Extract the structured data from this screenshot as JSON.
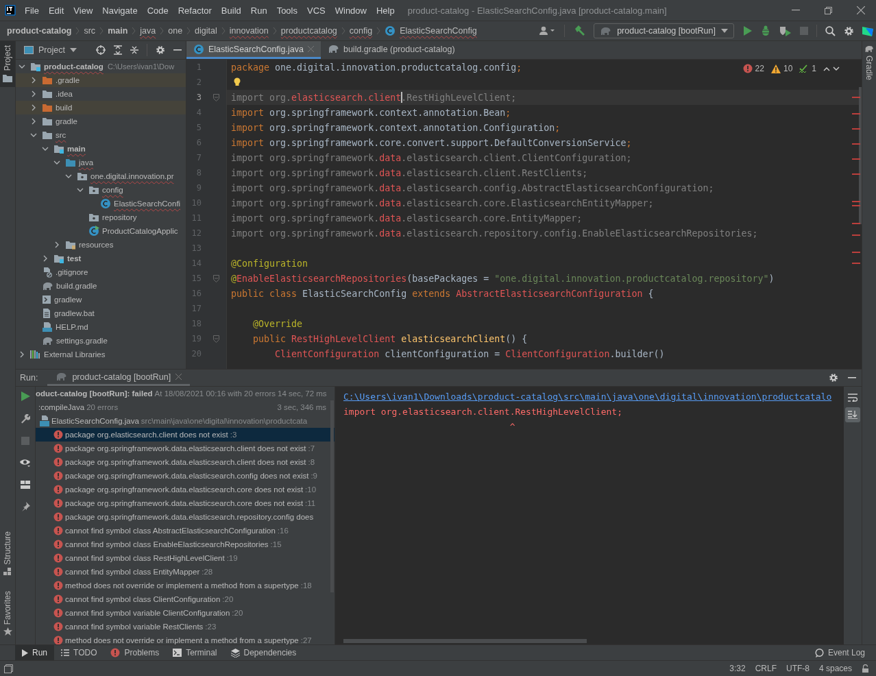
{
  "window": {
    "title": "product-catalog - ElasticSearchConfig.java [product-catalog.main]"
  },
  "menu": [
    "File",
    "Edit",
    "View",
    "Navigate",
    "Code",
    "Refactor",
    "Build",
    "Run",
    "Tools",
    "VCS",
    "Window",
    "Help"
  ],
  "breadcrumbs": [
    {
      "label": "product-catalog",
      "kind": "plain",
      "bold": true,
      "typo": false
    },
    {
      "label": "src",
      "kind": "plain",
      "bold": false,
      "typo": false
    },
    {
      "label": "main",
      "kind": "plain",
      "bold": true,
      "typo": false
    },
    {
      "label": "java",
      "kind": "plain",
      "bold": false,
      "typo": true
    },
    {
      "label": "one",
      "kind": "plain",
      "bold": false,
      "typo": false
    },
    {
      "label": "digital",
      "kind": "plain",
      "bold": false,
      "typo": false
    },
    {
      "label": "innovation",
      "kind": "plain",
      "bold": false,
      "typo": true
    },
    {
      "label": "productcatalog",
      "kind": "plain",
      "bold": false,
      "typo": true
    },
    {
      "label": "config",
      "kind": "plain",
      "bold": false,
      "typo": true
    },
    {
      "label": "ElasticSearchConfig",
      "kind": "class",
      "bold": false,
      "typo": true
    }
  ],
  "toolbar": {
    "run_config": "product-catalog [bootRun]"
  },
  "left_strip": {
    "top": [
      {
        "label": "Project",
        "selected": true
      }
    ],
    "bottom": [
      {
        "label": "Structure",
        "kind": "structure"
      },
      {
        "label": "Favorites",
        "kind": "favorites"
      }
    ]
  },
  "right_strip": [
    {
      "label": "Gradle"
    }
  ],
  "project": {
    "title": "Project",
    "tree": [
      {
        "label": "product-catalog",
        "path": "C:\\Users\\ivan1\\Dow",
        "kind": "module",
        "bold": true,
        "typo": true,
        "expanded": true,
        "children": [
          {
            "label": ".gradle",
            "kind": "excluded-folder",
            "bold": false,
            "typo": false,
            "expanded": false
          },
          {
            "label": ".idea",
            "kind": "folder",
            "bold": false,
            "typo": false,
            "expanded": false
          },
          {
            "label": "build",
            "kind": "excluded-folder",
            "bold": false,
            "typo": false,
            "expanded": false
          },
          {
            "label": "gradle",
            "kind": "folder",
            "bold": false,
            "typo": false,
            "expanded": false
          },
          {
            "label": "src",
            "kind": "folder",
            "bold": false,
            "typo": true,
            "expanded": true,
            "children": [
              {
                "label": "main",
                "kind": "module",
                "bold": true,
                "typo": true,
                "expanded": true,
                "children": [
                  {
                    "label": "java",
                    "kind": "source-folder",
                    "bold": false,
                    "typo": true,
                    "expanded": true,
                    "children": [
                      {
                        "label": "one.digital.innovation.pr",
                        "kind": "package",
                        "bold": false,
                        "typo": true,
                        "expanded": true,
                        "children": [
                          {
                            "label": "config",
                            "kind": "package",
                            "bold": false,
                            "typo": true,
                            "expanded": true,
                            "children": [
                              {
                                "label": "ElasticSearchConfi",
                                "kind": "class",
                                "bold": false,
                                "typo": true
                              }
                            ]
                          },
                          {
                            "label": "repository",
                            "kind": "package",
                            "bold": false,
                            "typo": false
                          },
                          {
                            "label": "ProductCatalogApplic",
                            "kind": "main-class",
                            "bold": false,
                            "typo": false
                          }
                        ]
                      }
                    ]
                  },
                  {
                    "label": "resources",
                    "kind": "resources-folder",
                    "bold": false,
                    "typo": false,
                    "expanded": false
                  }
                ]
              },
              {
                "label": "test",
                "kind": "module",
                "bold": true,
                "typo": false,
                "expanded": false
              }
            ]
          },
          {
            "label": ".gitignore",
            "kind": "ignore-file",
            "bold": false,
            "typo": false
          },
          {
            "label": "build.gradle",
            "kind": "gradle",
            "bold": false,
            "typo": false
          },
          {
            "label": "gradlew",
            "kind": "script",
            "bold": false,
            "typo": false
          },
          {
            "label": "gradlew.bat",
            "kind": "text-file",
            "bold": false,
            "typo": false
          },
          {
            "label": "HELP.md",
            "kind": "markdown",
            "bold": false,
            "typo": false
          },
          {
            "label": "settings.gradle",
            "kind": "gradle",
            "bold": false,
            "typo": false
          }
        ]
      },
      {
        "label": "External Libraries",
        "kind": "libraries",
        "bold": false,
        "typo": false,
        "expanded": false
      }
    ]
  },
  "editor": {
    "tabs": [
      {
        "label": "ElasticSearchConfig.java",
        "kind": "class",
        "selected": true
      },
      {
        "label": "build.gradle (product-catalog)",
        "kind": "gradle",
        "selected": false
      }
    ],
    "inspections": {
      "errors": "22",
      "warnings": "10",
      "typos": "1"
    },
    "lines": [
      {
        "number": "1",
        "current": false,
        "fold": false,
        "bulb": false,
        "tokens": [
          {
            "kind": "kw",
            "text": "package "
          },
          {
            "kind": "plain",
            "text": "one.digital.innovation.productcatalog.config"
          },
          {
            "kind": "kw",
            "text": ";"
          }
        ]
      },
      {
        "number": "2",
        "current": false,
        "fold": false,
        "bulb": true
      },
      {
        "number": "3",
        "current": true,
        "fold": true,
        "bulb": false,
        "tokens": [
          {
            "kind": "grey",
            "text": "import org."
          },
          {
            "kind": "red",
            "text": "elasticsearch.client"
          },
          {
            "kind": "grey",
            "text": ".RestHighLevelClient;"
          }
        ]
      },
      {
        "number": "4",
        "current": false,
        "fold": false,
        "bulb": false,
        "tokens": [
          {
            "kind": "kw",
            "text": "import "
          },
          {
            "kind": "plain",
            "text": "org.springframework.context.annotation.Bean"
          },
          {
            "kind": "kw",
            "text": ";"
          }
        ]
      },
      {
        "number": "5",
        "current": false,
        "fold": false,
        "bulb": false,
        "tokens": [
          {
            "kind": "kw",
            "text": "import "
          },
          {
            "kind": "plain",
            "text": "org.springframework.context.annotation.Configuration"
          },
          {
            "kind": "kw",
            "text": ";"
          }
        ]
      },
      {
        "number": "6",
        "current": false,
        "fold": false,
        "bulb": false,
        "tokens": [
          {
            "kind": "kw",
            "text": "import "
          },
          {
            "kind": "plain",
            "text": "org.springframework.core.convert.support.DefaultConversionService"
          },
          {
            "kind": "kw",
            "text": ";"
          }
        ]
      },
      {
        "number": "7",
        "current": false,
        "fold": false,
        "bulb": false,
        "tokens": [
          {
            "kind": "grey",
            "text": "import org.springframework."
          },
          {
            "kind": "red",
            "text": "data"
          },
          {
            "kind": "grey",
            "text": ".elasticsearch.client.ClientConfiguration;"
          }
        ]
      },
      {
        "number": "8",
        "current": false,
        "fold": false,
        "bulb": false,
        "tokens": [
          {
            "kind": "grey",
            "text": "import org.springframework."
          },
          {
            "kind": "red",
            "text": "data"
          },
          {
            "kind": "grey",
            "text": ".elasticsearch.client.RestClients;"
          }
        ]
      },
      {
        "number": "9",
        "current": false,
        "fold": false,
        "bulb": false,
        "tokens": [
          {
            "kind": "grey",
            "text": "import org.springframework."
          },
          {
            "kind": "red",
            "text": "data"
          },
          {
            "kind": "grey",
            "text": ".elasticsearch.config.AbstractElasticsearchConfiguration;"
          }
        ]
      },
      {
        "number": "10",
        "current": false,
        "fold": false,
        "bulb": false,
        "tokens": [
          {
            "kind": "grey",
            "text": "import org.springframework."
          },
          {
            "kind": "red",
            "text": "data"
          },
          {
            "kind": "grey",
            "text": ".elasticsearch.core.ElasticsearchEntityMapper;"
          }
        ]
      },
      {
        "number": "11",
        "current": false,
        "fold": false,
        "bulb": false,
        "tokens": [
          {
            "kind": "grey",
            "text": "import org.springframework."
          },
          {
            "kind": "red",
            "text": "data"
          },
          {
            "kind": "grey",
            "text": ".elasticsearch.core.EntityMapper;"
          }
        ]
      },
      {
        "number": "12",
        "current": false,
        "fold": false,
        "bulb": false,
        "tokens": [
          {
            "kind": "grey",
            "text": "import org.springframework."
          },
          {
            "kind": "red",
            "text": "data"
          },
          {
            "kind": "grey",
            "text": ".elasticsearch.repository.config.EnableElasticsearchRepositories;"
          }
        ]
      },
      {
        "number": "13",
        "current": false,
        "fold": false,
        "bulb": false
      },
      {
        "number": "14",
        "current": false,
        "fold": false,
        "bulb": false,
        "tokens": [
          {
            "kind": "ann",
            "text": "@Configuration"
          }
        ]
      },
      {
        "number": "15",
        "current": false,
        "fold": true,
        "bulb": false,
        "tokens": [
          {
            "kind": "ann",
            "text": "@"
          },
          {
            "kind": "red",
            "text": "EnableElasticsearchRepositories"
          },
          {
            "kind": "plain",
            "text": "(basePackages = "
          },
          {
            "kind": "str",
            "text": "\"one.digital.innovation.productcatalog.repository\""
          },
          {
            "kind": "plain",
            "text": ")"
          }
        ]
      },
      {
        "number": "16",
        "current": false,
        "fold": false,
        "bulb": false,
        "tokens": [
          {
            "kind": "kw",
            "text": "public class "
          },
          {
            "kind": "plain",
            "text": "ElasticSearchConfig "
          },
          {
            "kind": "kw",
            "text": "extends "
          },
          {
            "kind": "red",
            "text": "AbstractElasticsearchConfiguration"
          },
          {
            "kind": "plain",
            "text": " {"
          }
        ]
      },
      {
        "number": "17",
        "current": false,
        "fold": false,
        "bulb": false
      },
      {
        "number": "18",
        "current": false,
        "fold": false,
        "bulb": false,
        "tokens": [
          {
            "kind": "ann",
            "text": "    @Override"
          }
        ]
      },
      {
        "number": "19",
        "current": false,
        "fold": true,
        "bulb": false,
        "tokens": [
          {
            "kind": "kw",
            "text": "    public "
          },
          {
            "kind": "red",
            "text": "RestHighLevelClient "
          },
          {
            "kind": "method",
            "text": "elasticsearchClient"
          },
          {
            "kind": "plain",
            "text": "() {"
          }
        ]
      },
      {
        "number": "20",
        "current": false,
        "fold": false,
        "bulb": false,
        "tokens": [
          {
            "kind": "red",
            "text": "        ClientConfiguration "
          },
          {
            "kind": "plain",
            "text": "clientConfiguration = "
          },
          {
            "kind": "red",
            "text": "ClientConfiguration"
          },
          {
            "kind": "plain",
            "text": ".builder()"
          }
        ]
      }
    ]
  },
  "run": {
    "label": "Run:",
    "tab": "product-catalog [bootRun]",
    "root": {
      "name": "oduct-catalog [bootRun]: failed",
      "detail": "At 18/08/2021 00:16 with 20 errors",
      "time": "14 sec, 72 ms"
    },
    "task": {
      "name": ":compileJava",
      "detail": "20 errors",
      "time": "3 sec, 346 ms"
    },
    "file": {
      "name": "ElasticSearchConfig.java",
      "path": "src\\main\\java\\one\\digital\\innovation\\productcata"
    },
    "errors": [
      {
        "message": "package org.elasticsearch.client does not exist",
        "line": ":3",
        "selected": true
      },
      {
        "message": "package org.springframework.data.elasticsearch.client does not exist",
        "line": ":7",
        "selected": false
      },
      {
        "message": "package org.springframework.data.elasticsearch.client does not exist",
        "line": ":8",
        "selected": false
      },
      {
        "message": "package org.springframework.data.elasticsearch.config does not exist",
        "line": ":9",
        "selected": false
      },
      {
        "message": "package org.springframework.data.elasticsearch.core does not exist",
        "line": ":10",
        "selected": false
      },
      {
        "message": "package org.springframework.data.elasticsearch.core does not exist",
        "line": ":11",
        "selected": false
      },
      {
        "message": "package org.springframework.data.elasticsearch.repository.config does",
        "selected": false
      },
      {
        "message": "cannot find symbol class AbstractElasticsearchConfiguration",
        "line": ":16",
        "selected": false
      },
      {
        "message": "cannot find symbol class EnableElasticsearchRepositories",
        "line": ":15",
        "selected": false
      },
      {
        "message": "cannot find symbol class RestHighLevelClient",
        "line": ":19",
        "selected": false
      },
      {
        "message": "cannot find symbol class EntityMapper",
        "line": ":28",
        "selected": false
      },
      {
        "message": "method does not override or implement a method from a supertype",
        "line": ":18",
        "selected": false
      },
      {
        "message": "cannot find symbol class ClientConfiguration",
        "line": ":20",
        "selected": false
      },
      {
        "message": "cannot find symbol variable ClientConfiguration",
        "line": ":20",
        "selected": false
      },
      {
        "message": "cannot find symbol variable RestClients",
        "line": ":23",
        "selected": false
      },
      {
        "message": "method does not override or implement a method from a supertype",
        "line": ":27",
        "selected": false
      }
    ],
    "console": {
      "link": "C:\\Users\\ivan1\\Downloads\\product-catalog\\src\\main\\java\\one\\digital\\innovation\\productcatalo",
      "error": "import org.elasticsearch.client.RestHighLevelClient;",
      "caret": "                               ^"
    }
  },
  "bottom_tabs": [
    {
      "label": "Run",
      "kind": "run",
      "selected": true
    },
    {
      "label": "TODO",
      "kind": "todo",
      "selected": false
    },
    {
      "label": "Problems",
      "kind": "problems",
      "selected": false
    },
    {
      "label": "Terminal",
      "kind": "terminal",
      "selected": false
    },
    {
      "label": "Dependencies",
      "kind": "dependencies",
      "selected": false
    }
  ],
  "event_log": "Event Log",
  "status_bar": [
    "3:32",
    "CRLF",
    "UTF-8",
    "4 spaces"
  ]
}
